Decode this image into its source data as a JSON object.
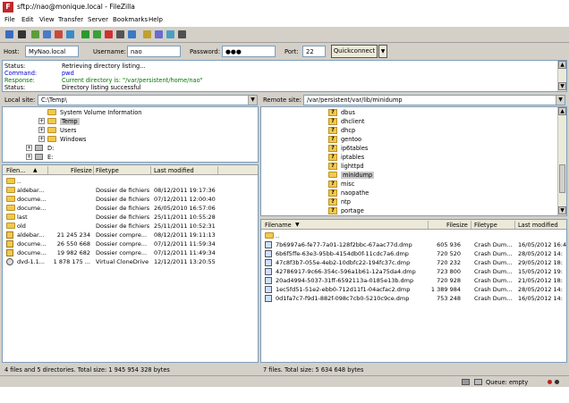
{
  "window": {
    "title": "sftp://nao@monique.local - FileZilla",
    "app_icon_letter": "F"
  },
  "menu": [
    "File",
    "Edit",
    "View",
    "Transfer",
    "Server",
    "Bookmarks",
    "Help"
  ],
  "toolbar": {
    "icons": [
      "site-manager-icon",
      "dropdown-arrow-icon",
      "message-log-icon",
      "local-tree-icon",
      "remote-tree-icon",
      "transfer-queue-icon",
      "refresh-icon",
      "process-queue-icon",
      "cancel-icon",
      "disconnect-icon",
      "reconnect-icon",
      "directory-listing-filters-icon",
      "compare-icon",
      "sync-browse-icon",
      "search-icon"
    ],
    "colors": [
      "#3a6bc4",
      "#333333",
      "#5a9e3a",
      "#4a7ac8",
      "#c84a3a",
      "#3a8ac8",
      "#2a9a2a",
      "#3aa03a",
      "#d03030",
      "#555555",
      "#3a7ac8",
      "#c0a030",
      "#6a6ad0",
      "#4aa0c0",
      "#505050"
    ]
  },
  "quickconnect": {
    "host_label": "Host:",
    "host_value": "MyNao.local",
    "username_label": "Username:",
    "username_value": "nao",
    "password_label": "Password:",
    "password_value": "●●●",
    "port_label": "Port:",
    "port_value": "22",
    "button_label": "Quickconnect",
    "dropdown": "▼"
  },
  "log": [
    {
      "key": "Status:",
      "value": "Retrieving directory listing...",
      "color": "#000000"
    },
    {
      "key": "Command:",
      "value": "pwd",
      "color": "#0000cc"
    },
    {
      "key": "Response:",
      "value": "Current directory is: \"/var/persistent/home/nao\"",
      "color": "#007700"
    },
    {
      "key": "Status:",
      "value": "Directory listing successful",
      "color": "#000000"
    }
  ],
  "local": {
    "site_label": "Local site:",
    "path": "C:\\Temp\\",
    "tree": [
      {
        "label": "System Volume Information",
        "level": 3,
        "expander": "",
        "selected": false,
        "drive": false
      },
      {
        "label": "Temp",
        "level": 3,
        "expander": "+",
        "selected": true,
        "drive": false
      },
      {
        "label": "Users",
        "level": 3,
        "expander": "+",
        "selected": false,
        "drive": false
      },
      {
        "label": "Windows",
        "level": 3,
        "expander": "+",
        "selected": false,
        "drive": false
      },
      {
        "label": "D:",
        "level": 1,
        "expander": "+",
        "selected": false,
        "drive": true
      },
      {
        "label": "E:",
        "level": 1,
        "expander": "+",
        "selected": false,
        "drive": true
      }
    ],
    "columns": [
      "Filen...",
      "Filesize",
      "Filetype",
      "Last modified"
    ],
    "sort_indicator": "▲",
    "files": [
      {
        "name": "..",
        "size": "",
        "type": "",
        "modified": "",
        "icon": "folder"
      },
      {
        "name": "aldebar...",
        "size": "",
        "type": "Dossier de fichiers",
        "modified": "08/12/2011 19:17:36",
        "icon": "folder"
      },
      {
        "name": "docume...",
        "size": "",
        "type": "Dossier de fichiers",
        "modified": "07/12/2011 12:00:40",
        "icon": "folder"
      },
      {
        "name": "docume...",
        "size": "",
        "type": "Dossier de fichiers",
        "modified": "26/05/2010 16:57:06",
        "icon": "folder"
      },
      {
        "name": "last",
        "size": "",
        "type": "Dossier de fichiers",
        "modified": "25/11/2011 10:55:28",
        "icon": "folder"
      },
      {
        "name": "old",
        "size": "",
        "type": "Dossier de fichiers",
        "modified": "25/11/2011 10:52:31",
        "icon": "folder"
      },
      {
        "name": "aldebar...",
        "size": "21 245 234",
        "type": "Dossier compre...",
        "modified": "08/12/2011 19:11:13",
        "icon": "zip"
      },
      {
        "name": "docume...",
        "size": "26 550 668",
        "type": "Dossier compre...",
        "modified": "07/12/2011 11:59:34",
        "icon": "zip"
      },
      {
        "name": "docume...",
        "size": "19 982 682",
        "type": "Dossier compre...",
        "modified": "07/12/2011 11:49:34",
        "icon": "zip"
      },
      {
        "name": "dvd-1.1...",
        "size": "1 878 175 ...",
        "type": "Virtual CloneDrive",
        "modified": "12/12/2011 13:20:55",
        "icon": "dvd"
      }
    ],
    "status": "4 files and 5 directories. Total size: 1 945 954 328 bytes"
  },
  "remote": {
    "site_label": "Remote site:",
    "path": "/var/persistent/var/lib/minidump",
    "tree": [
      {
        "label": "dbus",
        "selected": false,
        "q": true
      },
      {
        "label": "dhclient",
        "selected": false,
        "q": true
      },
      {
        "label": "dhcp",
        "selected": false,
        "q": true
      },
      {
        "label": "gentoo",
        "selected": false,
        "q": true
      },
      {
        "label": "ip6tables",
        "selected": false,
        "q": true
      },
      {
        "label": "iptables",
        "selected": false,
        "q": true
      },
      {
        "label": "lighttpd",
        "selected": false,
        "q": true
      },
      {
        "label": "minidump",
        "selected": true,
        "q": false
      },
      {
        "label": "misc",
        "selected": false,
        "q": true
      },
      {
        "label": "naopathe",
        "selected": false,
        "q": true
      },
      {
        "label": "ntp",
        "selected": false,
        "q": true
      },
      {
        "label": "portage",
        "selected": false,
        "q": true
      }
    ],
    "columns": [
      "Filename",
      "Filesize",
      "Filetype",
      "Last modified"
    ],
    "sort_indicator": "▼",
    "files": [
      {
        "name": "..",
        "size": "",
        "type": "",
        "modified": "",
        "icon": "folder"
      },
      {
        "name": "7b6997a6-fe77-7a01-128f2bbc-67aac77d.dmp",
        "size": "605 936",
        "type": "Crash Dum...",
        "modified": "16/05/2012 16:4",
        "icon": "dmp"
      },
      {
        "name": "6b6f5ffe-63e3-95bb-4154db0f-11cdc7a6.dmp",
        "size": "720 520",
        "type": "Crash Dum...",
        "modified": "28/05/2012 14:",
        "icon": "dmp"
      },
      {
        "name": "47c8f3b7-055e-4eb2-10dbfc22-194fc37c.dmp",
        "size": "720 232",
        "type": "Crash Dum...",
        "modified": "29/05/2012 18:",
        "icon": "dmp"
      },
      {
        "name": "42786917-9c66-354c-596a1b61-12a75da4.dmp",
        "size": "723 800",
        "type": "Crash Dum...",
        "modified": "15/05/2012 19:",
        "icon": "dmp"
      },
      {
        "name": "20ad4994-5037-31ff-6592113a-0185e13b.dmp",
        "size": "720 928",
        "type": "Crash Dum...",
        "modified": "21/05/2012 18:",
        "icon": "dmp"
      },
      {
        "name": "1ec5fd51-51e2-ebb0-712d11f1-04acfac2.dmp",
        "size": "1 389 984",
        "type": "Crash Dum...",
        "modified": "28/05/2012 14:",
        "icon": "dmp"
      },
      {
        "name": "0d1fa7c7-f9d1-882f-098c7cb0-5210c9ce.dmp",
        "size": "753 248",
        "type": "Crash Dum...",
        "modified": "16/05/2012 14:",
        "icon": "dmp"
      }
    ],
    "status": "7 files. Total size: 5 634 648 bytes"
  },
  "statusbar": {
    "queue": "Queue: empty",
    "led_colors": [
      "#c02020",
      "#303030"
    ]
  }
}
